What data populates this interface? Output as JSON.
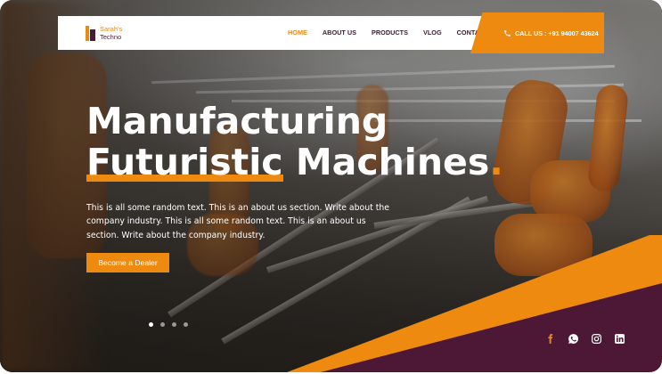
{
  "header": {
    "logo": {
      "line1": "Sarah's",
      "line2": "Techno"
    },
    "menu": [
      {
        "label": "HOME",
        "active": true
      },
      {
        "label": "ABOUT US",
        "active": false
      },
      {
        "label": "PRODUCTS",
        "active": false
      },
      {
        "label": "VLOG",
        "active": false
      },
      {
        "label": "CONTACT",
        "active": false
      }
    ],
    "call": {
      "label": "CALL US : +91 94007 43624",
      "icon": "phone-icon"
    }
  },
  "hero": {
    "title_line1": "Manufacturing",
    "title_line2_highlight": "Futuristic",
    "title_line2_rest": " Machines",
    "title_dot": ".",
    "text": "This is all some random text. This is an about us section. Write about the company industry. This is all some random text. This is an about us section. Write about the company industry.",
    "cta_label": "Become a Dealer"
  },
  "slider": {
    "count": 4,
    "active_index": 0
  },
  "socials": [
    {
      "name": "facebook-icon"
    },
    {
      "name": "whatsapp-icon"
    },
    {
      "name": "instagram-icon"
    },
    {
      "name": "linkedin-icon"
    }
  ],
  "colors": {
    "accent": "#ee8a10",
    "dark": "#4d1835",
    "text": "#ffffff"
  }
}
